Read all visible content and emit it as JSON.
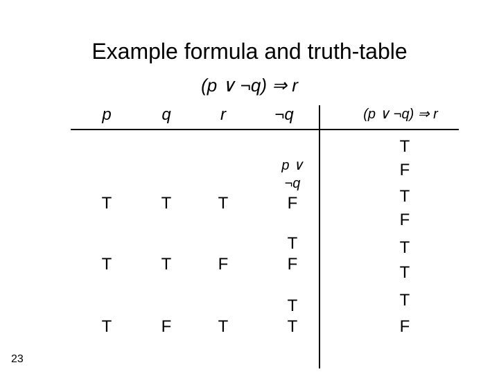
{
  "title": "Example formula and truth-table",
  "formula": "(p ∨ ¬q) ⇒ r",
  "headers": {
    "p": "p",
    "q": "q",
    "r": "r",
    "notq": "¬q",
    "full": "(p ∨ ¬q) ⇒ r"
  },
  "mid_labels": {
    "pv": "p ∨",
    "nq": "¬q"
  },
  "rows": {
    "r1": {
      "p": "T",
      "q": "T",
      "r": "T",
      "nq": "F",
      "extra1": "T",
      "extra2": "F"
    },
    "r2": {
      "p": "T",
      "q": "T",
      "r": "F"
    },
    "r3": {
      "p": "T",
      "q": "F",
      "r": "T",
      "nq": "T",
      "extra": "T"
    }
  },
  "results": [
    "T",
    "F",
    "T",
    "F",
    "T",
    "T",
    "T",
    "F"
  ],
  "page": "23",
  "chart_data": {
    "type": "table",
    "title": "Example formula and truth-table",
    "formula": "(p ∨ ¬q) ⇒ r",
    "columns": [
      "p",
      "q",
      "r",
      "¬q",
      "p ∨ ¬q",
      "(p ∨ ¬q) ⇒ r"
    ],
    "visible_rows": [
      {
        "p": "T",
        "q": "T",
        "r": "T",
        "¬q": "F"
      },
      {
        "p": "T",
        "q": "T",
        "r": "F",
        "¬q": "F"
      },
      {
        "p": "T",
        "q": "F",
        "r": "T",
        "¬q": "T"
      }
    ],
    "result_column_visible": [
      "T",
      "F",
      "T",
      "F",
      "T",
      "T",
      "T",
      "F"
    ]
  }
}
